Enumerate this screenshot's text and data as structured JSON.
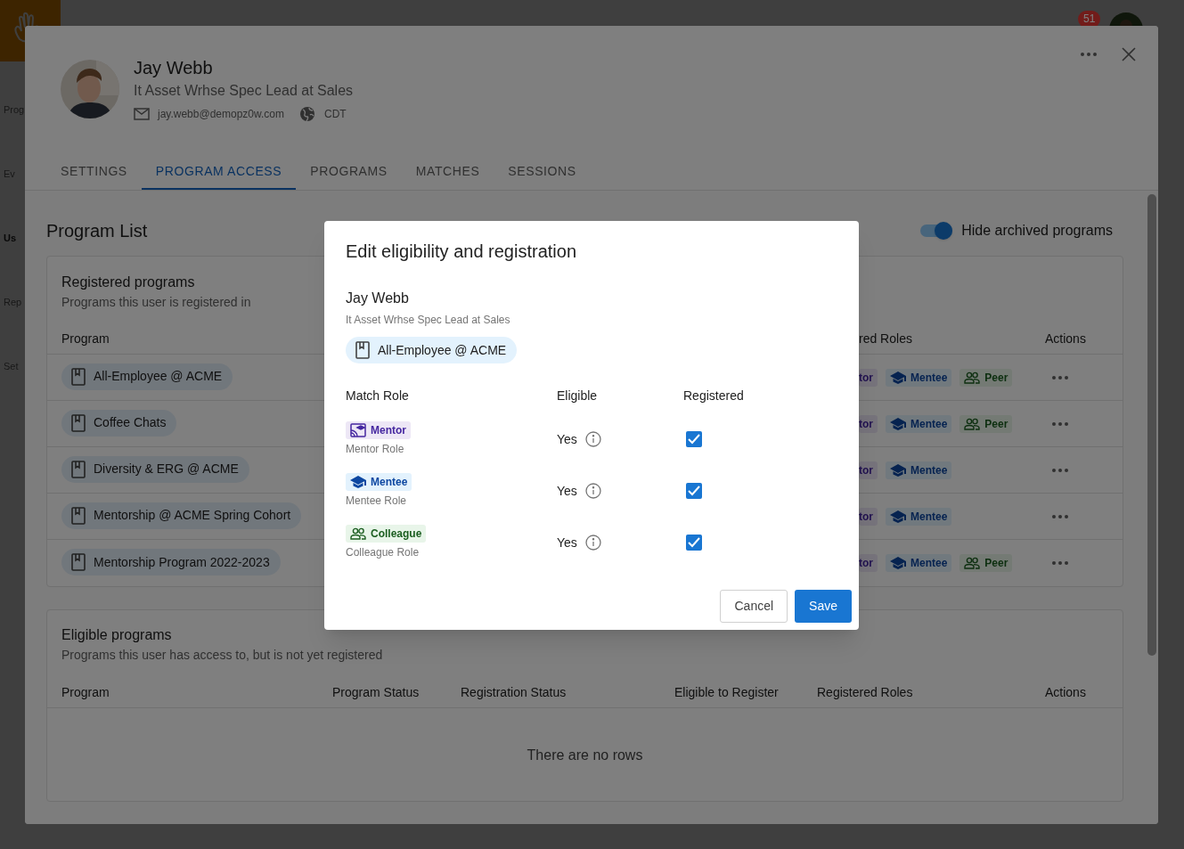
{
  "sidebar": {
    "items": [
      {
        "label": "Prog",
        "selected": false
      },
      {
        "label": "Ev",
        "selected": false
      },
      {
        "label": "Us",
        "selected": true
      },
      {
        "label": "Rep",
        "selected": false
      },
      {
        "label": "Set",
        "selected": false
      }
    ]
  },
  "top_bar": {
    "notification_count": "51"
  },
  "user_panel": {
    "name": "Jay Webb",
    "title": "It Asset Wrhse Spec Lead at Sales",
    "email": "jay.webb@demopz0w.com",
    "timezone": "CDT",
    "tabs": [
      {
        "label": "SETTINGS",
        "selected": false
      },
      {
        "label": "PROGRAM ACCESS",
        "selected": true
      },
      {
        "label": "PROGRAMS",
        "selected": false
      },
      {
        "label": "MATCHES",
        "selected": false
      },
      {
        "label": "SESSIONS",
        "selected": false
      }
    ],
    "heading": "Program List",
    "archive_toggle": {
      "label": "Hide archived programs",
      "on": true
    },
    "registered": {
      "title": "Registered programs",
      "subtitle": "Programs this user is registered in",
      "columns": [
        "Program",
        "red Roles",
        "Actions"
      ],
      "rows": [
        {
          "program": "All-Employee @ ACME",
          "roles": [
            {
              "kind": "mentor",
              "label": "tor"
            },
            {
              "kind": "mentee",
              "label": "Mentee"
            },
            {
              "kind": "peer",
              "label": "Peer"
            }
          ]
        },
        {
          "program": "Coffee Chats",
          "roles": [
            {
              "kind": "mentor",
              "label": "tor"
            },
            {
              "kind": "mentee",
              "label": "Mentee"
            },
            {
              "kind": "peer",
              "label": "Peer"
            }
          ]
        },
        {
          "program": "Diversity & ERG @ ACME",
          "roles": [
            {
              "kind": "mentor",
              "label": "tor"
            },
            {
              "kind": "mentee",
              "label": "Mentee"
            }
          ]
        },
        {
          "program": "Mentorship @ ACME Spring Cohort",
          "roles": [
            {
              "kind": "mentor",
              "label": "tor"
            },
            {
              "kind": "mentee",
              "label": "Mentee"
            }
          ]
        },
        {
          "program": "Mentorship Program 2022-2023",
          "roles": [
            {
              "kind": "mentor",
              "label": "tor"
            },
            {
              "kind": "mentee",
              "label": "Mentee"
            },
            {
              "kind": "peer",
              "label": "Peer"
            }
          ]
        }
      ]
    },
    "eligible": {
      "title": "Eligible programs",
      "subtitle": "Programs this user has access to, but is not yet registered",
      "columns": [
        "Program",
        "Program Status",
        "Registration Status",
        "Eligible to Register",
        "Registered Roles",
        "Actions"
      ],
      "empty": "There are no rows"
    }
  },
  "dialog": {
    "title": "Edit eligibility and registration",
    "name": "Jay Webb",
    "subtitle": "It Asset Wrhse Spec Lead at Sales",
    "program": "All-Employee @ ACME",
    "columns": [
      "Match Role",
      "Eligible",
      "Registered"
    ],
    "roles": [
      {
        "kind": "mentor",
        "label": "Mentor",
        "description": "Mentor Role",
        "eligible": "Yes",
        "registered": true
      },
      {
        "kind": "mentee",
        "label": "Mentee",
        "description": "Mentee Role",
        "eligible": "Yes",
        "registered": true
      },
      {
        "kind": "colleague",
        "label": "Colleague",
        "description": "Colleague Role",
        "eligible": "Yes",
        "registered": true
      }
    ],
    "buttons": [
      "Cancel",
      "Save"
    ]
  }
}
